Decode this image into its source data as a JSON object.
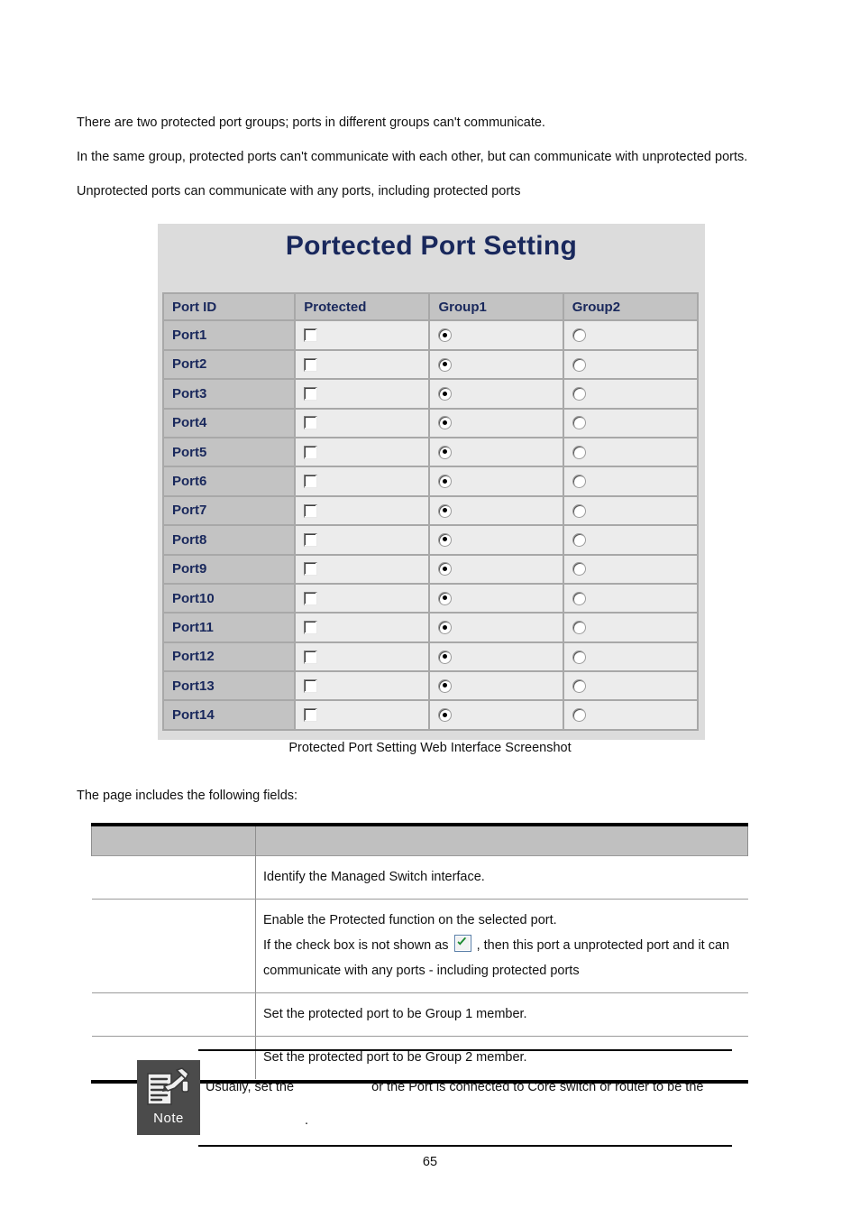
{
  "intro": {
    "lines": [
      "There are two protected port groups; ports in different groups can't communicate.",
      "In the same group, protected ports can't communicate with each other, but can communicate with unprotected ports.",
      "Unprotected ports can communicate with any ports, including protected ports"
    ]
  },
  "webui": {
    "title": "Portected Port Setting",
    "columns": [
      "Port ID",
      "Protected",
      "Group1",
      "Group2"
    ],
    "rows": [
      {
        "port_id": "Port1",
        "protected": false,
        "group1": true,
        "group2": false
      },
      {
        "port_id": "Port2",
        "protected": false,
        "group1": true,
        "group2": false
      },
      {
        "port_id": "Port3",
        "protected": false,
        "group1": true,
        "group2": false
      },
      {
        "port_id": "Port4",
        "protected": false,
        "group1": true,
        "group2": false
      },
      {
        "port_id": "Port5",
        "protected": false,
        "group1": true,
        "group2": false
      },
      {
        "port_id": "Port6",
        "protected": false,
        "group1": true,
        "group2": false
      },
      {
        "port_id": "Port7",
        "protected": false,
        "group1": true,
        "group2": false
      },
      {
        "port_id": "Port8",
        "protected": false,
        "group1": true,
        "group2": false
      },
      {
        "port_id": "Port9",
        "protected": false,
        "group1": true,
        "group2": false
      },
      {
        "port_id": "Port10",
        "protected": false,
        "group1": true,
        "group2": false
      },
      {
        "port_id": "Port11",
        "protected": false,
        "group1": true,
        "group2": false
      },
      {
        "port_id": "Port12",
        "protected": false,
        "group1": true,
        "group2": false
      },
      {
        "port_id": "Port13",
        "protected": false,
        "group1": true,
        "group2": false
      },
      {
        "port_id": "Port14",
        "protected": false,
        "group1": true,
        "group2": false
      }
    ],
    "colors": {
      "panel_bg": "#dcdcdc",
      "title": "#19285c",
      "header_bg": "#c3c3c3",
      "cell_bg": "#ececec",
      "border": "#a8a8a8"
    }
  },
  "caption": "Protected Port Setting Web Interface Screenshot",
  "lead": "The page includes the following fields:",
  "fields_table": {
    "headers": [
      "",
      ""
    ],
    "rows": [
      {
        "name": "",
        "desc_lines": [
          "Identify the Managed Switch interface."
        ]
      },
      {
        "name": "",
        "desc_lines": [
          "Enable the Protected function on the selected port.",
          "If the check box is not shown as",
          ", then this port a unprotected port and it can",
          "communicate with any ports - including protected ports"
        ]
      },
      {
        "name": "",
        "desc_lines": [
          "Set the protected port to be Group 1 member."
        ]
      },
      {
        "name": "",
        "desc_lines": [
          "Set the protected port to be Group 2 member."
        ]
      }
    ]
  },
  "note": {
    "label": "Note",
    "line1_a": "Usually, set the",
    "line1_b": "or the Port is connected to Core switch or router to be the",
    "line2": "."
  },
  "page_number": "65"
}
